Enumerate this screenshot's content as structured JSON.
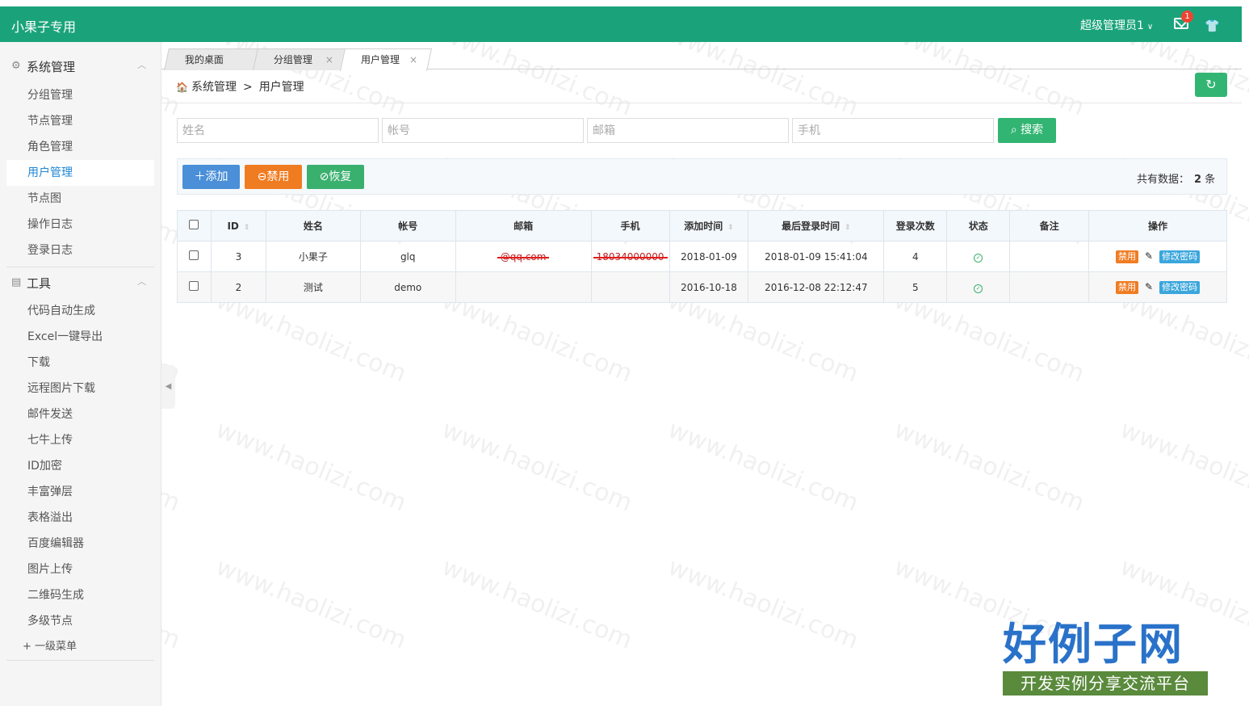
{
  "header": {
    "brand": "小果子专用",
    "user": "超级管理员1",
    "badge": "1"
  },
  "sidebar": {
    "sections": [
      {
        "label": "系统管理",
        "icon": "gear-icon",
        "items": [
          "分组管理",
          "节点管理",
          "角色管理",
          "用户管理",
          "节点图",
          "操作日志",
          "登录日志"
        ]
      },
      {
        "label": "工具",
        "icon": "table-icon",
        "items": [
          "代码自动生成",
          "Excel一键导出",
          "下载",
          "远程图片下载",
          "邮件发送",
          "七牛上传",
          "ID加密",
          "丰富弹层",
          "表格溢出",
          "百度编辑器",
          "图片上传",
          "二维码生成",
          "多级节点",
          "+ 一级菜单"
        ]
      }
    ],
    "active": "用户管理"
  },
  "tabs": [
    {
      "label": "我的桌面"
    },
    {
      "label": "分组管理",
      "close": "×"
    },
    {
      "label": "用户管理",
      "close": "×"
    }
  ],
  "breadcrumb": {
    "root": "系统管理",
    "sep": ">",
    "current": "用户管理"
  },
  "search": {
    "name_placeholder": "姓名",
    "account_placeholder": "帐号",
    "email_placeholder": "邮箱",
    "phone_placeholder": "手机",
    "button": "搜索"
  },
  "toolbar": {
    "add": "添加",
    "ban": "禁用",
    "restore": "恢复",
    "total_label": "共有数据：",
    "total_count": "2",
    "total_unit": "条"
  },
  "table": {
    "headers": [
      "ID",
      "姓名",
      "帐号",
      "邮箱",
      "手机",
      "添加时间",
      "最后登录时间",
      "登录次数",
      "状态",
      "备注",
      "操作"
    ],
    "rows": [
      {
        "id": "3",
        "name": "小果子",
        "account": "glq",
        "email": "@qq.com",
        "phone": "18034000000",
        "added": "2018-01-09",
        "last_login": "2018-01-09 15:41:04",
        "logins": "4",
        "note": "",
        "ban": "禁用",
        "pwd": "修改密码"
      },
      {
        "id": "2",
        "name": "测试",
        "account": "demo",
        "email": "",
        "phone": "",
        "added": "2016-10-18",
        "last_login": "2016-12-08 22:12:47",
        "logins": "5",
        "note": "",
        "ban": "禁用",
        "pwd": "修改密码"
      }
    ]
  },
  "watermark": {
    "text": "www.haolizi.com",
    "logo_title": "好例子网",
    "logo_subtitle": "开发实例分享交流平台"
  }
}
